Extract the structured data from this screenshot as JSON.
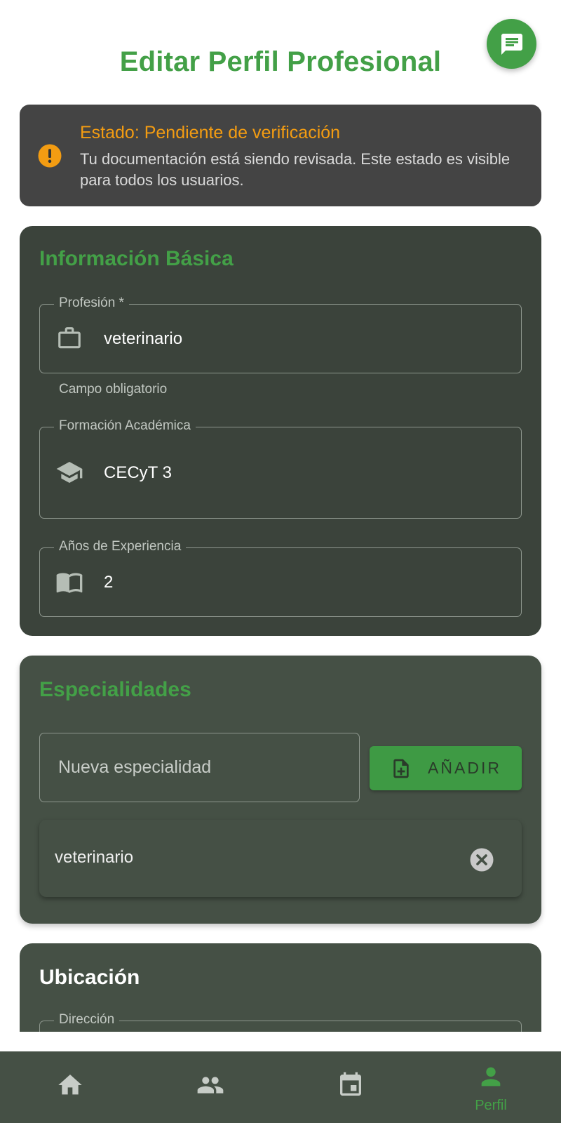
{
  "header": {
    "title": "Editar Perfil Profesional"
  },
  "status": {
    "title": "Estado: Pendiente de verificación",
    "message": "Tu documentación está siendo revisada. Este estado es visible para todos los usuarios."
  },
  "basic_info": {
    "title": "Información Básica",
    "profession": {
      "label": "Profesión *",
      "value": "veterinario",
      "helper": "Campo obligatorio"
    },
    "education": {
      "label": "Formación Académica",
      "value": "CECyT 3"
    },
    "experience": {
      "label": "Años de Experiencia",
      "value": "2"
    }
  },
  "specialties": {
    "title": "Especialidades",
    "input_placeholder": "Nueva especialidad",
    "add_label": "AÑADIR",
    "items": [
      {
        "label": "veterinario"
      }
    ]
  },
  "location": {
    "title": "Ubicación",
    "address": {
      "label": "Dirección"
    }
  },
  "nav": {
    "items": [
      {
        "icon": "home-icon",
        "label": ""
      },
      {
        "icon": "people-icon",
        "label": ""
      },
      {
        "icon": "calendar-icon",
        "label": ""
      },
      {
        "icon": "person-icon",
        "label": "Perfil"
      }
    ]
  },
  "colors": {
    "accent": "#43a047",
    "warning": "#f39c12",
    "card_dark": "#3b433b",
    "card": "#455045"
  }
}
